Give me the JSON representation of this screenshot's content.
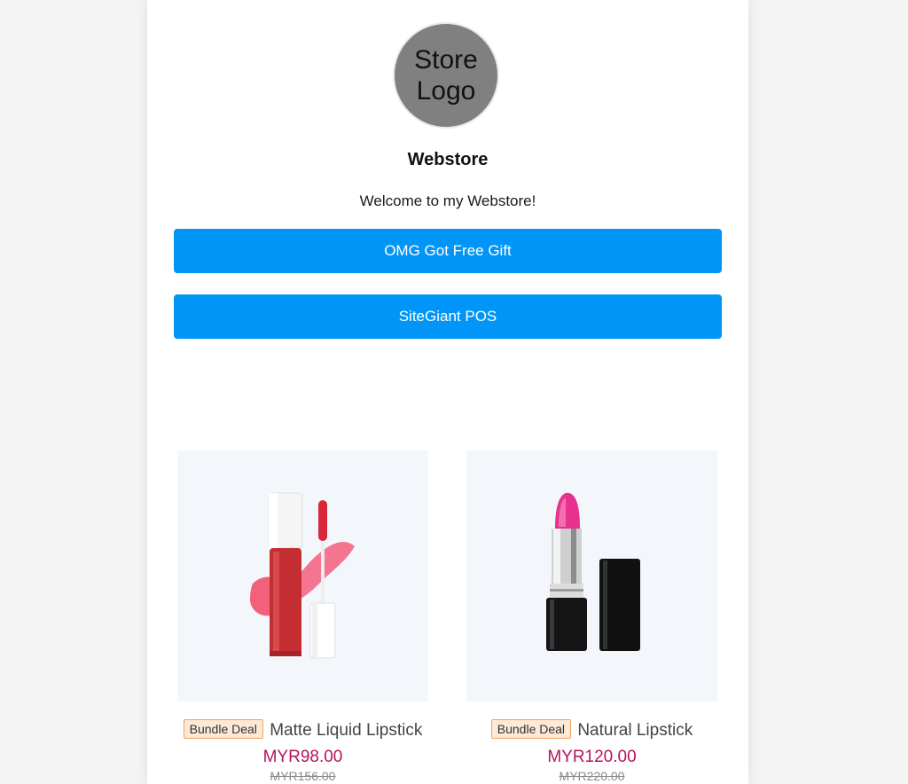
{
  "store": {
    "logo_text": "Store Logo",
    "name": "Webstore",
    "welcome": "Welcome to my Webstore!"
  },
  "links": [
    {
      "label": "OMG Got Free Gift"
    },
    {
      "label": "SiteGiant POS"
    }
  ],
  "products": [
    {
      "badge": "Bundle Deal",
      "name": "Matte Liquid Lipstick",
      "price": "MYR98.00",
      "old_price": "MYR156.00",
      "image_icon": "liquid-lipstick-image"
    },
    {
      "badge": "Bundle Deal",
      "name": "Natural Lipstick",
      "price": "MYR120.00",
      "old_price": "MYR220.00",
      "image_icon": "lipstick-image"
    }
  ],
  "colors": {
    "button_bg": "#0095f6",
    "price": "#b5135f",
    "badge_border": "#f0a35c",
    "badge_bg": "#fde9d6",
    "logo_bg": "#808080"
  }
}
